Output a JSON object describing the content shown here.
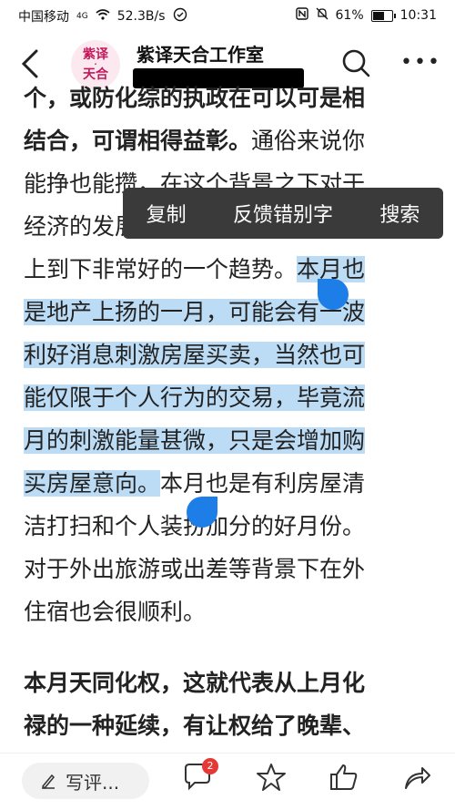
{
  "status_bar": {
    "carrier": "中国移动",
    "network": "4G",
    "speed": "52.3B/s",
    "battery": "61%",
    "time": "10:31"
  },
  "header": {
    "logo_text_top": "紫译",
    "logo_text_bottom": "天合",
    "title": "紫译天合工作室"
  },
  "article": {
    "line0_partial": "个，或防化综的执政在可以可是相",
    "line1_bold": "结合，可谓相得益彰。",
    "line1_rest": "通俗来说你",
    "line2": "能挣也能攒，在这个背景之下对于",
    "line3": "经济的发展上也是个好，可以说从",
    "line4_plain": "上到下非常好的一个趋势。",
    "line4_hl": "本月也",
    "line5_hl": "是地产上扬的一月，可能会有一波",
    "line6_hl": "利好消息刺激房屋买卖，当然也可",
    "line7_hl": "能仅限于个人行为的交易，毕竟流",
    "line8_hl": "月的刺激能量甚微，只是会增加购",
    "line9_hl": "买房屋意向。",
    "line9_rest": "本月也是有利房屋清",
    "line10": "洁打扫和个人装扮加分的好月份。",
    "line11": "对于外出旅游或出差等背景下在外",
    "line12": "住宿也会很顺利。",
    "p2_line1": "本月天同化权，这就代表从上月化",
    "p2_line2": "禄的一种延续，有让权给了晚辈、"
  },
  "context_menu": {
    "copy": "复制",
    "report_typo": "反馈错别字",
    "search": "搜索"
  },
  "bottom_bar": {
    "comment_placeholder": "写评...",
    "comment_count": "2"
  }
}
